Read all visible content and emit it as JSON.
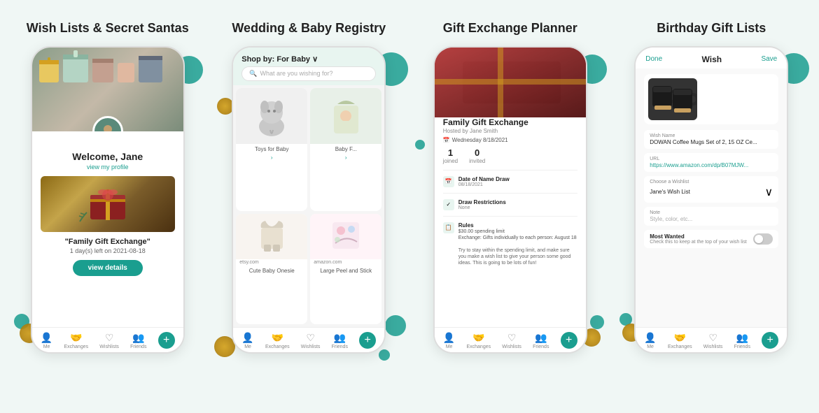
{
  "sections": [
    {
      "id": "wish-lists",
      "title": "Wish Lists & Secret Santas",
      "phone": {
        "welcome": "Welcome, Jane",
        "profile_link": "view my profile",
        "exchange_title": "\"Family Gift Exchange\"",
        "exchange_subtitle": "1 day(s) left on 2021-08-18",
        "view_btn": "view details",
        "nav": [
          "Me",
          "Exchanges",
          "Wishlists",
          "Friends"
        ]
      }
    },
    {
      "id": "wedding-registry",
      "title": "Wedding & Baby Registry",
      "phone": {
        "shop_by": "Shop by: For Baby ∨",
        "search_placeholder": "What are you wishing for?",
        "products": [
          {
            "label": "Toys for Baby",
            "emoji": "🐘"
          },
          {
            "label": "Baby F...",
            "emoji": "👶"
          },
          {
            "source": "etsy.com",
            "label": "Cute Baby Onesie",
            "emoji": "👕"
          },
          {
            "source": "amazon.com",
            "label": "Large Peel and Stick",
            "emoji": "🎀"
          }
        ],
        "nav": [
          "Me",
          "Exchanges",
          "Wishlists",
          "Friends"
        ]
      }
    },
    {
      "id": "gift-exchange",
      "title": "Gift Exchange Planner",
      "phone": {
        "exchange_name": "Family Gift Exchange",
        "hosted_by": "Hosted by Jane Smith",
        "date": "Wednesday 8/18/2021",
        "joined": "1",
        "joined_label": "joined",
        "invited": "0",
        "invited_label": "invited",
        "sections": [
          {
            "label": "Date of Name Draw",
            "value": "08/18/2021",
            "icon": "📅"
          },
          {
            "label": "Draw Restrictions",
            "value": "None",
            "icon": "✓"
          },
          {
            "label": "Rules",
            "value": "$30.00 spending limit\nExchange: Gifts individually to\neach person: August 18\n\nTry to stay within the spending limit, and make sure you make a wish list to give your person some good ideas. This is going to be lots of fun!",
            "icon": "📋"
          }
        ],
        "nav": [
          "Me",
          "Exchanges",
          "Wishlists",
          "Friends"
        ]
      }
    },
    {
      "id": "birthday-gift",
      "title": "Birthday Gift Lists",
      "phone": {
        "header_done": "Done",
        "header_title": "Wish",
        "header_save": "Save",
        "product_emoji": "☕",
        "fields": [
          {
            "label": "Wish Name",
            "value": "DOWAN Coffee Mugs Set of 2, 15 OZ Ce..."
          },
          {
            "label": "URL",
            "value": "https://www.amazon.com/dp/B07MJW..."
          },
          {
            "label": "Choose a Wishlist",
            "value": "Jane's Wish List",
            "select": true
          },
          {
            "label": "Note",
            "value": "Style, color, etc..."
          },
          {
            "label": "Most Wanted",
            "sublabel": "Check this to keep at the top of your wish list",
            "toggle": true
          }
        ],
        "nav": [
          "Me",
          "Exchanges",
          "Wishlists",
          "Friends"
        ]
      }
    }
  ]
}
